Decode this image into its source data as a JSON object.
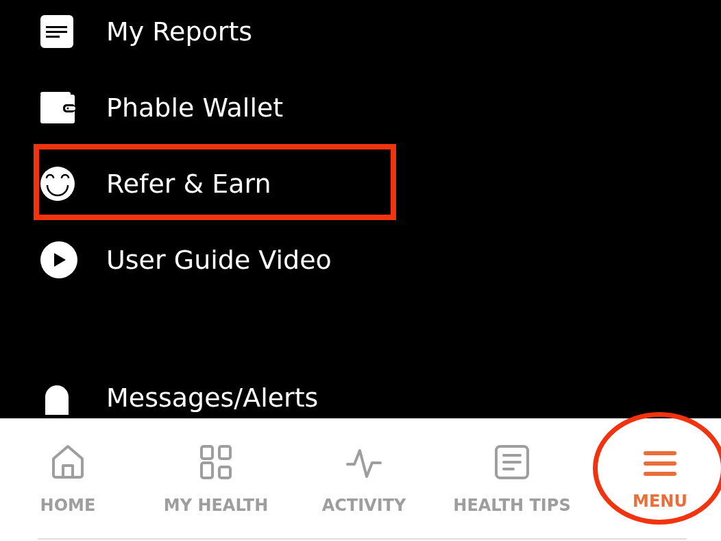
{
  "menu_sections": [
    [
      {
        "label": "My Reports",
        "highlighted": false
      },
      {
        "label": "Phable Wallet",
        "highlighted": false
      },
      {
        "label": "Refer & Earn",
        "highlighted": true
      },
      {
        "label": "User Guide Video",
        "highlighted": false
      }
    ],
    [
      {
        "label": "Messages/Alerts",
        "highlighted": false
      }
    ]
  ],
  "bottom_nav": [
    {
      "label": "HOME",
      "selected": false,
      "highlighted": false
    },
    {
      "label": "MY HEALTH",
      "selected": false,
      "highlighted": false
    },
    {
      "label": "ACTIVITY",
      "selected": false,
      "highlighted": false
    },
    {
      "label": "HEALTH TIPS",
      "selected": false,
      "highlighted": false
    },
    {
      "label": "MENU",
      "selected": true,
      "highlighted": true
    }
  ]
}
